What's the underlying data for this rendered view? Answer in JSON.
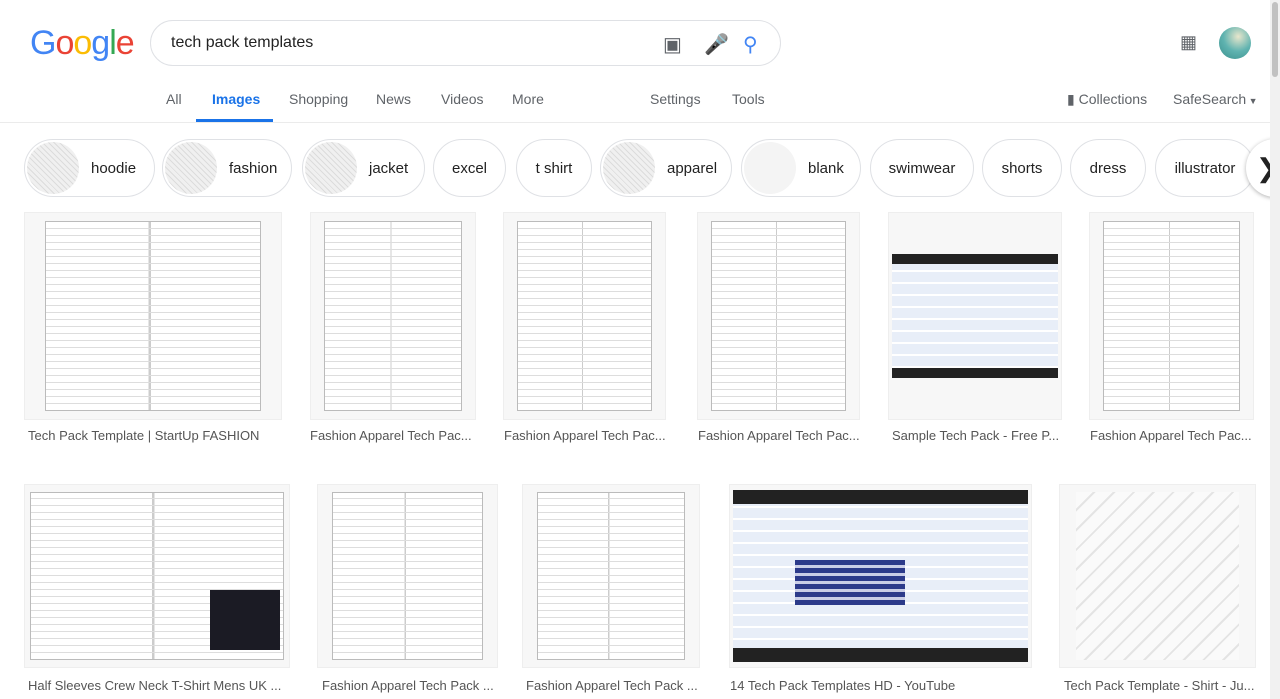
{
  "logo": "Google",
  "search": {
    "query": "tech pack templates"
  },
  "tabs": [
    "All",
    "Images",
    "Shopping",
    "News",
    "Videos",
    "More",
    "Settings",
    "Tools"
  ],
  "right_tools": {
    "collections": "Collections",
    "safesearch": "SafeSearch"
  },
  "chips": [
    "hoodie",
    "fashion",
    "jacket",
    "excel",
    "t shirt",
    "apparel",
    "blank",
    "swimwear",
    "shorts",
    "dress",
    "illustrator"
  ],
  "results": [
    "Tech Pack Template | StartUp FASHION",
    "Fashion Apparel Tech Pac...",
    "Fashion Apparel Tech Pac...",
    "Fashion Apparel Tech Pac...",
    "Sample Tech Pack - Free P...",
    "Fashion Apparel Tech Pac...",
    "Half Sleeves Crew Neck T-Shirt Mens UK ...",
    "Fashion Apparel Tech Pack ...",
    "Fashion Apparel Tech Pack ...",
    "14 Tech Pack Templates HD - YouTube",
    "Tech Pack Template - Shirt - Ju..."
  ]
}
